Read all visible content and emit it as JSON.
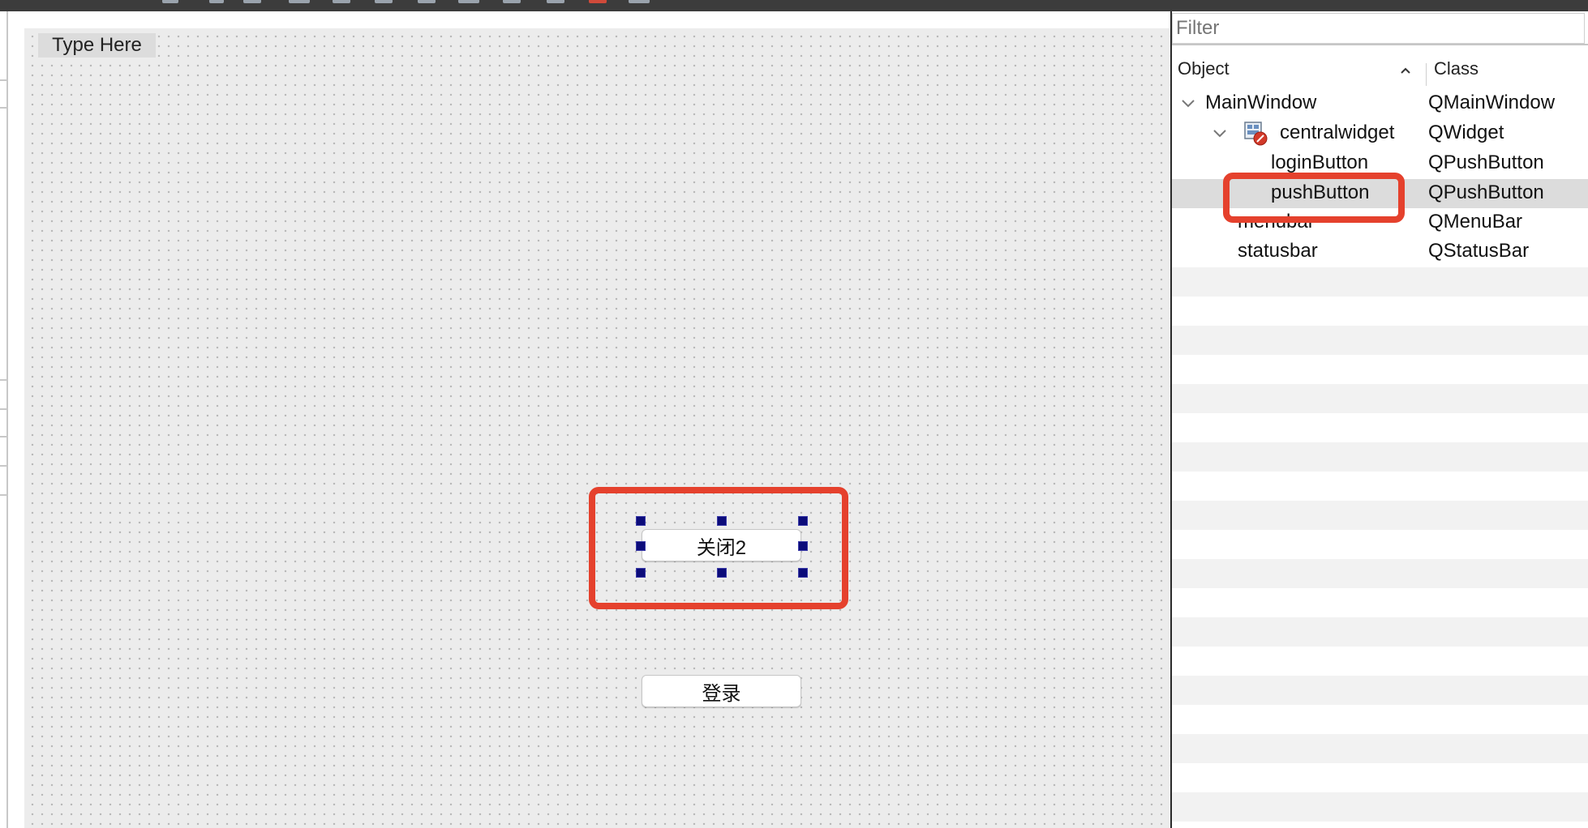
{
  "form": {
    "menu_placeholder": "Type Here",
    "buttons": {
      "close": "关闭2",
      "login": "登录"
    }
  },
  "object_inspector": {
    "filter_placeholder": "Filter",
    "columns": {
      "object": "Object",
      "class": "Class"
    },
    "rows": [
      {
        "object": "MainWindow",
        "class": "QMainWindow"
      },
      {
        "object": "centralwidget",
        "class": "QWidget"
      },
      {
        "object": "loginButton",
        "class": "QPushButton"
      },
      {
        "object": "pushButton",
        "class": "QPushButton"
      },
      {
        "object": "menubar",
        "class": "QMenuBar"
      },
      {
        "object": "statusbar",
        "class": "QStatusBar"
      }
    ],
    "selected_row": "pushButton"
  },
  "colors": {
    "highlight": "#e5412d",
    "selection_handle": "#0c0c7a",
    "selected_row": "#dcdcdc"
  },
  "icons": [
    "chevron-down-icon",
    "widget-icon",
    "sort-ascending-icon"
  ]
}
